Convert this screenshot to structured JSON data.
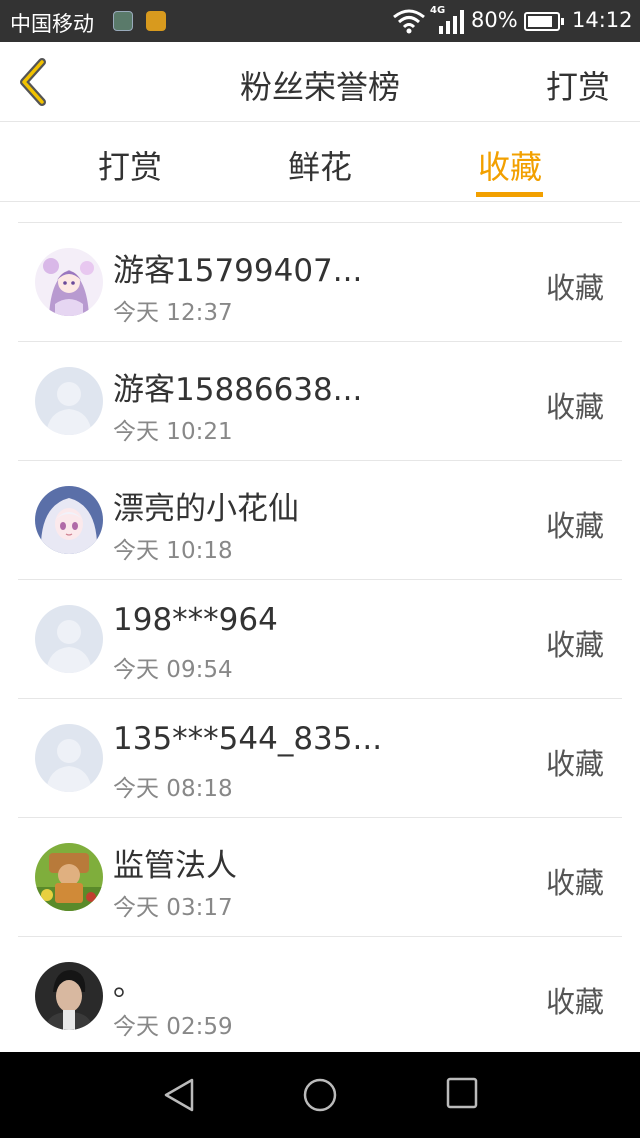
{
  "status_bar": {
    "carrier": "中国移动",
    "network": "4G",
    "battery": "80%",
    "time": "14:12"
  },
  "header": {
    "title": "粉丝荣誉榜",
    "action": "打赏"
  },
  "tabs": [
    {
      "label": "打赏",
      "active": false
    },
    {
      "label": "鲜花",
      "active": false
    },
    {
      "label": "收藏",
      "active": true
    }
  ],
  "colors": {
    "accent": "#f2a000",
    "text": "#333333",
    "subtext": "#888888",
    "status_bar": "#333333"
  },
  "list": [
    {
      "name": "游客15799407...",
      "time": "今天 12:37",
      "tag": "收藏",
      "avatar": "anime-girl-pink"
    },
    {
      "name": "游客15886638...",
      "time": "今天 10:21",
      "tag": "收藏",
      "avatar": "default-person"
    },
    {
      "name": "漂亮的小花仙",
      "time": "今天 10:18",
      "tag": "收藏",
      "avatar": "anime-girl-white"
    },
    {
      "name": "198***964",
      "time": "今天 09:54",
      "tag": "收藏",
      "avatar": "default-person"
    },
    {
      "name": "135***544_835...",
      "time": "今天 08:18",
      "tag": "收藏",
      "avatar": "default-person"
    },
    {
      "name": "监管法人",
      "time": "今天 03:17",
      "tag": "收藏",
      "avatar": "game-character"
    },
    {
      "name": "。",
      "time": "今天 02:59",
      "tag": "收藏",
      "avatar": "man-photo"
    }
  ]
}
